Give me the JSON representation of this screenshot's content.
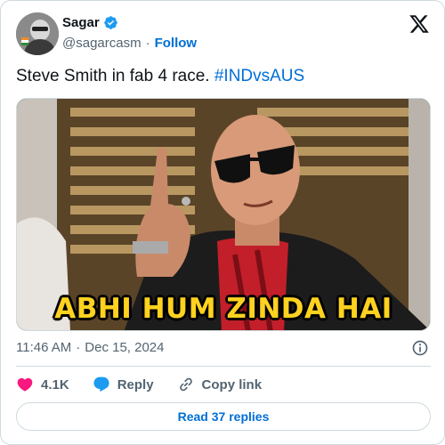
{
  "author": {
    "display_name": "Sagar",
    "handle": "@sagarcasm",
    "separator": "·",
    "follow_label": "Follow"
  },
  "tweet": {
    "text": "Steve Smith in fab 4 race.",
    "hashtag": "#INDvsAUS"
  },
  "media": {
    "caption": "ABHI HUM ZINDA HAI"
  },
  "meta": {
    "time": "11:46 AM",
    "separator": "·",
    "date": "Dec 15, 2024"
  },
  "actions": {
    "like_count": "4.1K",
    "reply_label": "Reply",
    "copy_link_label": "Copy link"
  },
  "read_replies_label": "Read 37 replies",
  "colors": {
    "link_blue": "#006fd6",
    "like_red": "#f91880",
    "reply_blue": "#1d9bf0",
    "verified_blue": "#1d9bf0",
    "caption_yellow": "#ffd21f"
  }
}
